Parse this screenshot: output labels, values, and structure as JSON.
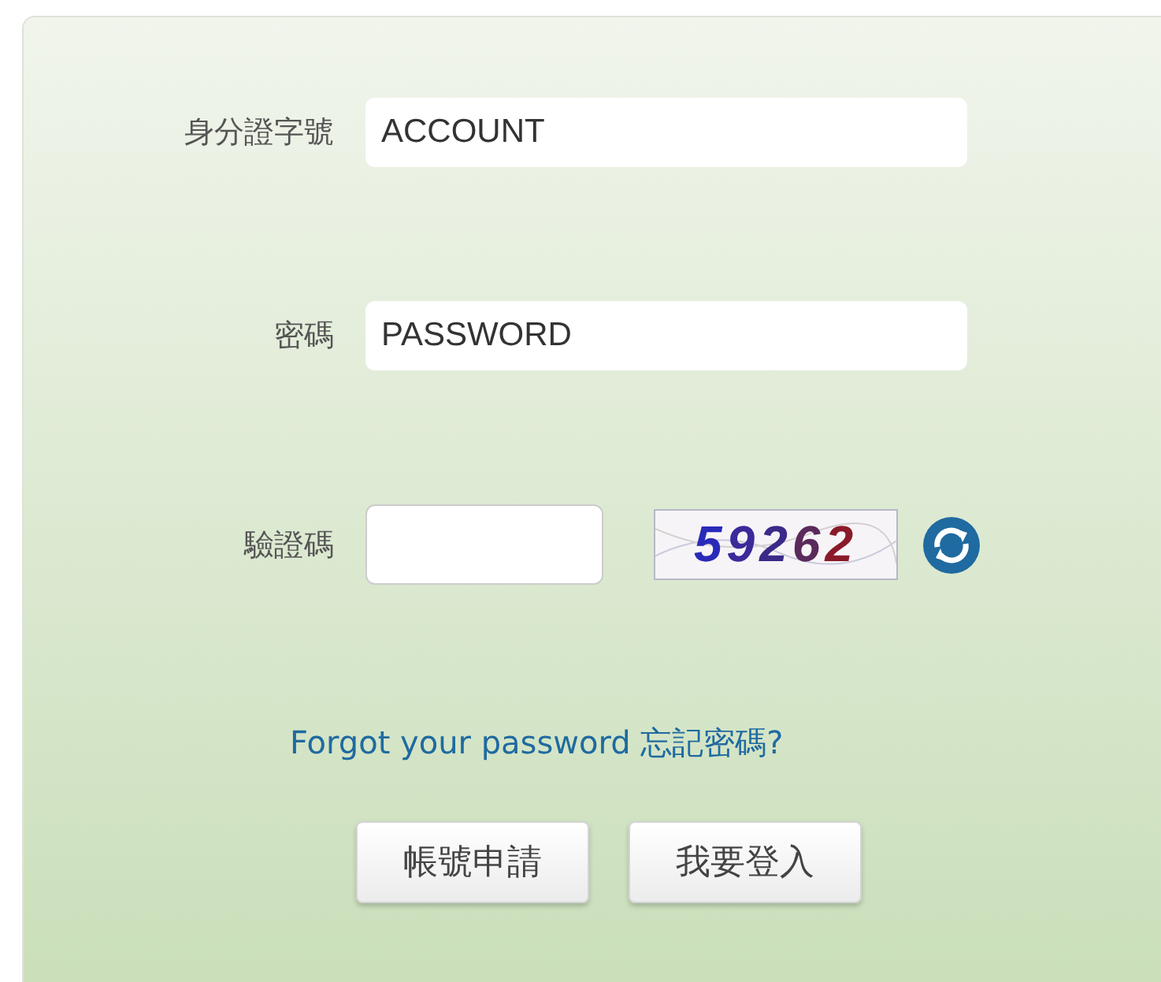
{
  "fields": [
    {
      "label": "身分證字號",
      "placeholder": "ACCOUNT",
      "kind": "text"
    },
    {
      "label": "密碼",
      "placeholder": "PASSWORD",
      "kind": "password"
    },
    {
      "label": "驗證碼",
      "kind": "captcha",
      "captcha": "59262"
    }
  ],
  "forgot_link": "Forgot your password 忘記密碼?",
  "buttons": [
    "帳號申請",
    "我要登入"
  ]
}
